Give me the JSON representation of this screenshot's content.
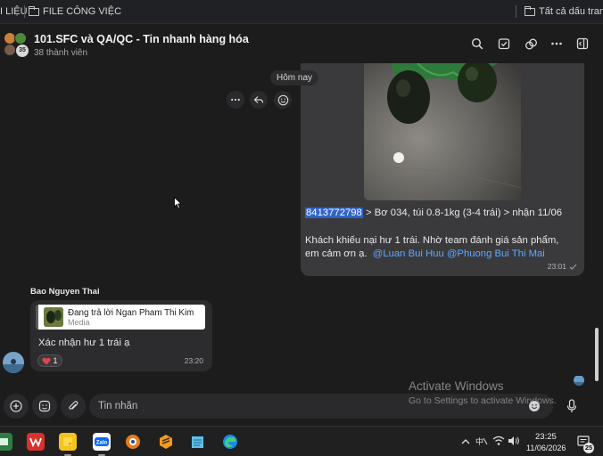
{
  "bookmarks": {
    "left_items": [
      {
        "label": "I LIỆU"
      },
      {
        "label": "FILE CÔNG VIỆC"
      }
    ],
    "all_bookmarks_label": "Tất cả dấu trang"
  },
  "header": {
    "group_title": "101.SFC và QA/QC - Tin nhanh hàng hóa",
    "member_count": "38 thành viên",
    "avatar_badge": "35",
    "action_icons": [
      "search-icon",
      "checkbox-icon",
      "link-icon",
      "more-icon",
      "sidebar-toggle-icon"
    ]
  },
  "messages": {
    "date_chip": "Hôm nay",
    "sent": {
      "order_id": "8413772798",
      "line1_rest": " > Bơ 034, túi 0.8-1kg (3-4 trái) > nhận 11/06",
      "line2": "Khách khiếu nại hư 1 trái. Nhờ team đánh giá sản phẩm, em cảm ơn ạ.",
      "mentions": [
        "@Luan Bui Huu",
        "@Phuong Bui Thi Mai"
      ],
      "time": "23:01"
    },
    "received": {
      "sender": "Bao Nguyen Thai",
      "reply_to": "Đang trả lời Ngan Pham Thi Kim",
      "reply_type": "Media",
      "text": "Xác nhận hư 1 trái ạ",
      "reaction_count": "1",
      "time": "23:20"
    }
  },
  "input": {
    "placeholder": "Tin nhắn"
  },
  "watermark": {
    "title": "Activate Windows",
    "subtitle": "Go to Settings to activate Windows."
  },
  "taskbar": {
    "time": "23:25",
    "date": "11/06/2026",
    "notification_count": "25",
    "apps": [
      "weread",
      "wps",
      "sticky-notes",
      "zalo",
      "ultraviewer",
      "sublime",
      "notepad",
      "edge"
    ]
  },
  "colors": {
    "background": "#1c1c1d",
    "sent_bubble": "#3a3a3c",
    "received_bubble": "#2c2c2e",
    "mention": "#5fa8ff",
    "highlight": "#2f64c8"
  }
}
